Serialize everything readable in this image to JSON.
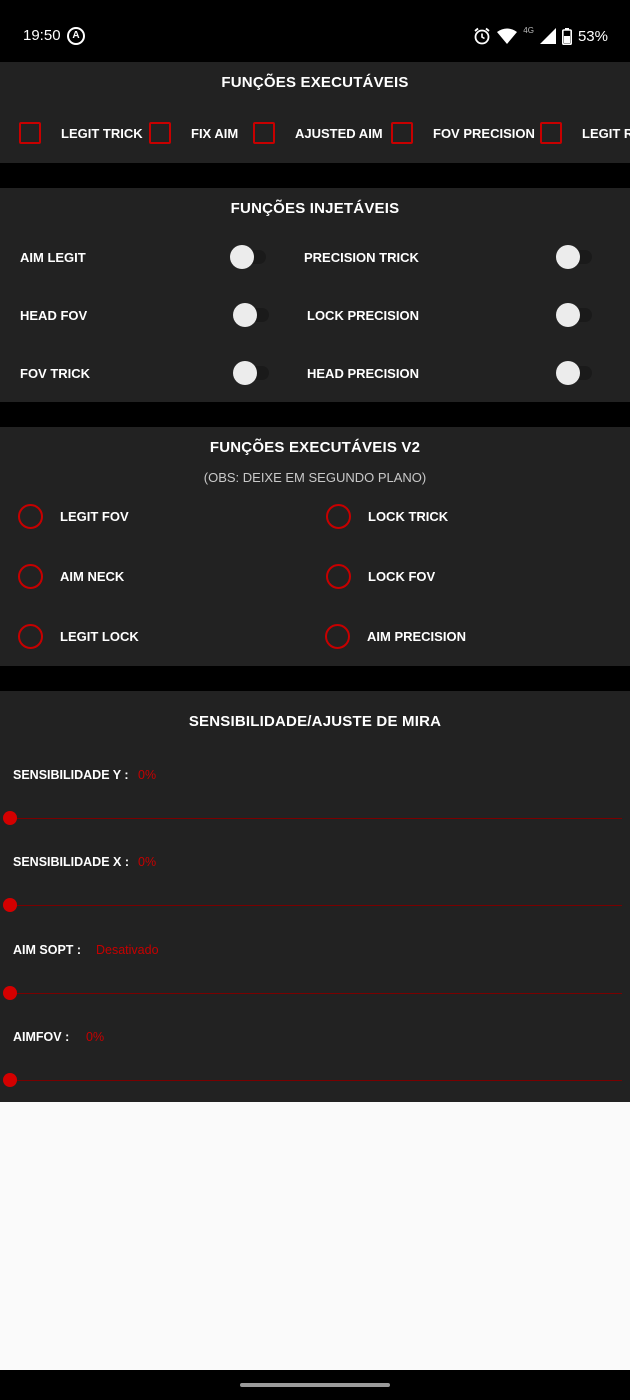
{
  "status_bar": {
    "time": "19:50",
    "badge": "A",
    "network": "4G",
    "battery": "53%",
    "icons": [
      "alarm-icon",
      "wifi-icon",
      "signal-icon",
      "battery-icon"
    ]
  },
  "panel1": {
    "title": "FUNÇÕES EXECUTÁVEIS",
    "items": [
      {
        "label": "LEGIT TRICK",
        "checked": false
      },
      {
        "label": "FIX AIM",
        "checked": false
      },
      {
        "label": "AJUSTED AIM",
        "checked": false
      },
      {
        "label": "FOV PRECISION",
        "checked": false
      },
      {
        "label": "LEGIT RE",
        "checked": false
      }
    ]
  },
  "panel2": {
    "title": "FUNÇÕES INJETÁVEIS",
    "switches": [
      {
        "label": "AIM LEGIT",
        "on": false
      },
      {
        "label": "PRECISION TRICK",
        "on": false
      },
      {
        "label": "HEAD FOV",
        "on": false
      },
      {
        "label": "LOCK PRECISION",
        "on": false
      },
      {
        "label": "FOV TRICK",
        "on": false
      },
      {
        "label": "HEAD PRECISION",
        "on": false
      }
    ]
  },
  "panel3": {
    "title": "FUNÇÕES EXECUTÁVEIS V2",
    "subtitle": "(OBS: DEIXE EM SEGUNDO PLANO)",
    "radios": [
      {
        "label": "LEGIT FOV",
        "selected": false
      },
      {
        "label": "LOCK TRICK",
        "selected": false
      },
      {
        "label": "AIM NECK",
        "selected": false
      },
      {
        "label": "LOCK FOV",
        "selected": false
      },
      {
        "label": "LEGIT LOCK",
        "selected": false
      },
      {
        "label": "AIM PRECISION",
        "selected": false
      }
    ]
  },
  "panel4": {
    "title": "SENSIBILIDADE/AJUSTE DE MIRA",
    "sliders": [
      {
        "label": "SENSIBILIDADE Y :",
        "value": "0%",
        "level": 0
      },
      {
        "label": "SENSIBILIDADE X :",
        "value": "0%",
        "level": 0
      },
      {
        "label": "AIM SOPT :",
        "value": "Desativado",
        "level": 0
      },
      {
        "label": "AIMFOV :",
        "value": "0%",
        "level": 0
      }
    ]
  },
  "colors": {
    "panel_bg": "#222222",
    "accent": "#c70000",
    "background": "#000000"
  }
}
